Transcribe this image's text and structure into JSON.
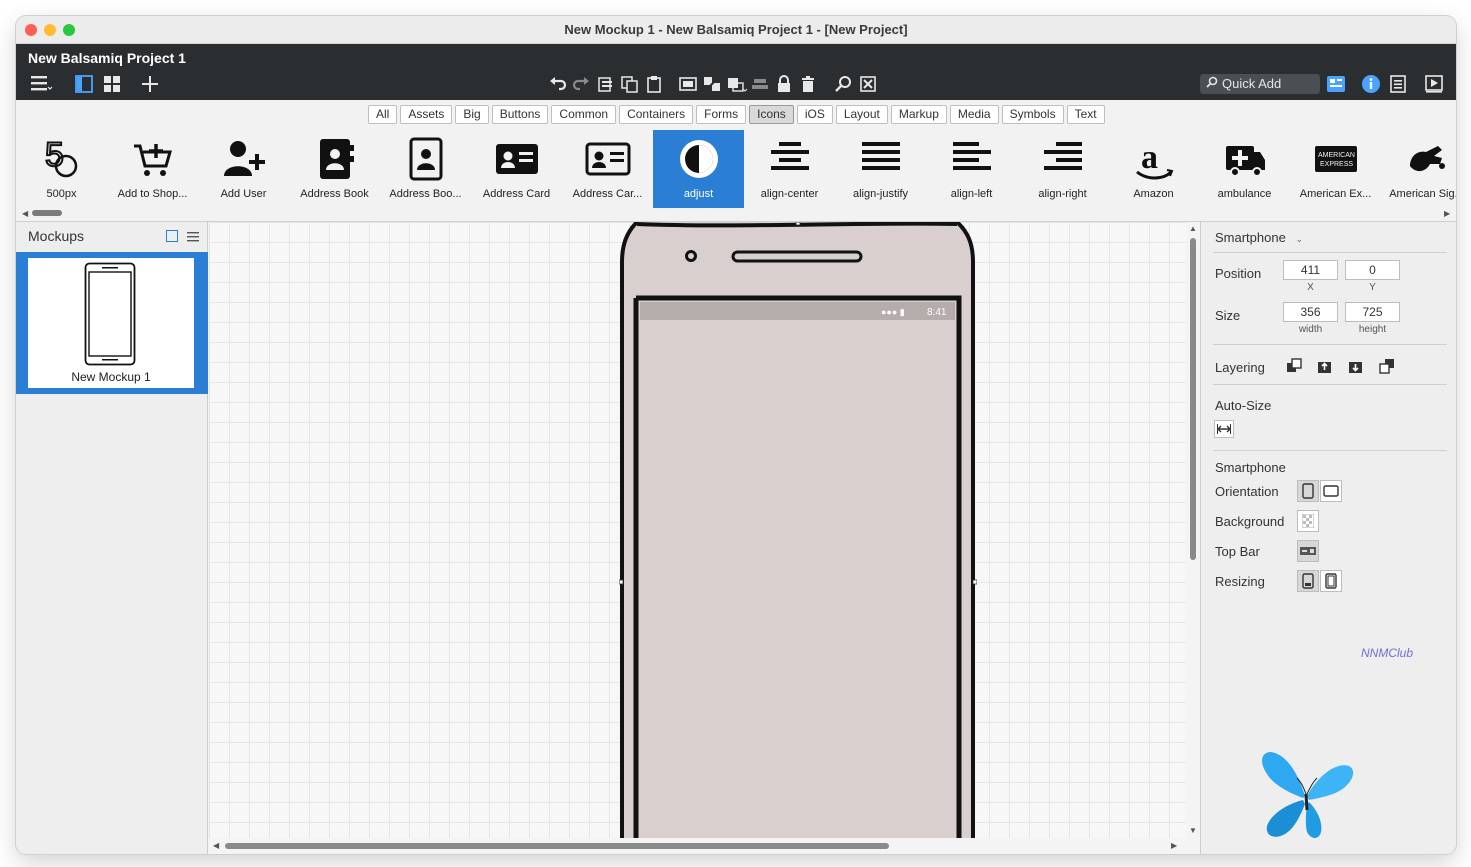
{
  "window": {
    "title": "New Mockup 1 - New Balsamiq Project 1 - [New Project]"
  },
  "toolbar": {
    "project_name": "New Balsamiq Project 1",
    "quick_add_placeholder": "Quick Add"
  },
  "categories": {
    "items": [
      "All",
      "Assets",
      "Big",
      "Buttons",
      "Common",
      "Containers",
      "Forms",
      "Icons",
      "iOS",
      "Layout",
      "Markup",
      "Media",
      "Symbols",
      "Text"
    ],
    "selected": "Icons"
  },
  "icon_library": {
    "items": [
      {
        "label": "500px",
        "icon": "500px-icon"
      },
      {
        "label": "Add to Shop...",
        "icon": "add-to-shopping-cart-icon"
      },
      {
        "label": "Add User",
        "icon": "add-user-icon"
      },
      {
        "label": "Address Book",
        "icon": "address-book-icon"
      },
      {
        "label": "Address Boo...",
        "icon": "address-book-outline-icon"
      },
      {
        "label": "Address Card",
        "icon": "address-card-icon"
      },
      {
        "label": "Address Car...",
        "icon": "address-card-outline-icon"
      },
      {
        "label": "adjust",
        "icon": "adjust-icon"
      },
      {
        "label": "align-center",
        "icon": "align-center-icon"
      },
      {
        "label": "align-justify",
        "icon": "align-justify-icon"
      },
      {
        "label": "align-left",
        "icon": "align-left-icon"
      },
      {
        "label": "align-right",
        "icon": "align-right-icon"
      },
      {
        "label": "Amazon",
        "icon": "amazon-icon"
      },
      {
        "label": "ambulance",
        "icon": "ambulance-icon"
      },
      {
        "label": "American Ex...",
        "icon": "american-express-icon"
      },
      {
        "label": "American Sig...",
        "icon": "american-sign-language-icon"
      }
    ],
    "selected": "adjust"
  },
  "mockups_panel": {
    "title": "Mockups",
    "mockups": [
      {
        "name": "New Mockup 1"
      }
    ]
  },
  "canvas": {
    "phone": {
      "status_time": "8:41"
    }
  },
  "inspector": {
    "control_type": "Smartphone",
    "position": {
      "label": "Position",
      "x": "411",
      "y": "0",
      "x_caption": "X",
      "y_caption": "Y"
    },
    "size": {
      "label": "Size",
      "width": "356",
      "height": "725",
      "width_caption": "width",
      "height_caption": "height"
    },
    "layering_label": "Layering",
    "auto_size_label": "Auto-Size",
    "section_title": "Smartphone",
    "orientation_label": "Orientation",
    "background_label": "Background",
    "top_bar_label": "Top Bar",
    "resizing_label": "Resizing",
    "watermark": "NNMClub"
  },
  "colors": {
    "accent": "#2a7fd4",
    "topbar": "#2b2e31",
    "phone_fill": "#d9cfcf"
  }
}
